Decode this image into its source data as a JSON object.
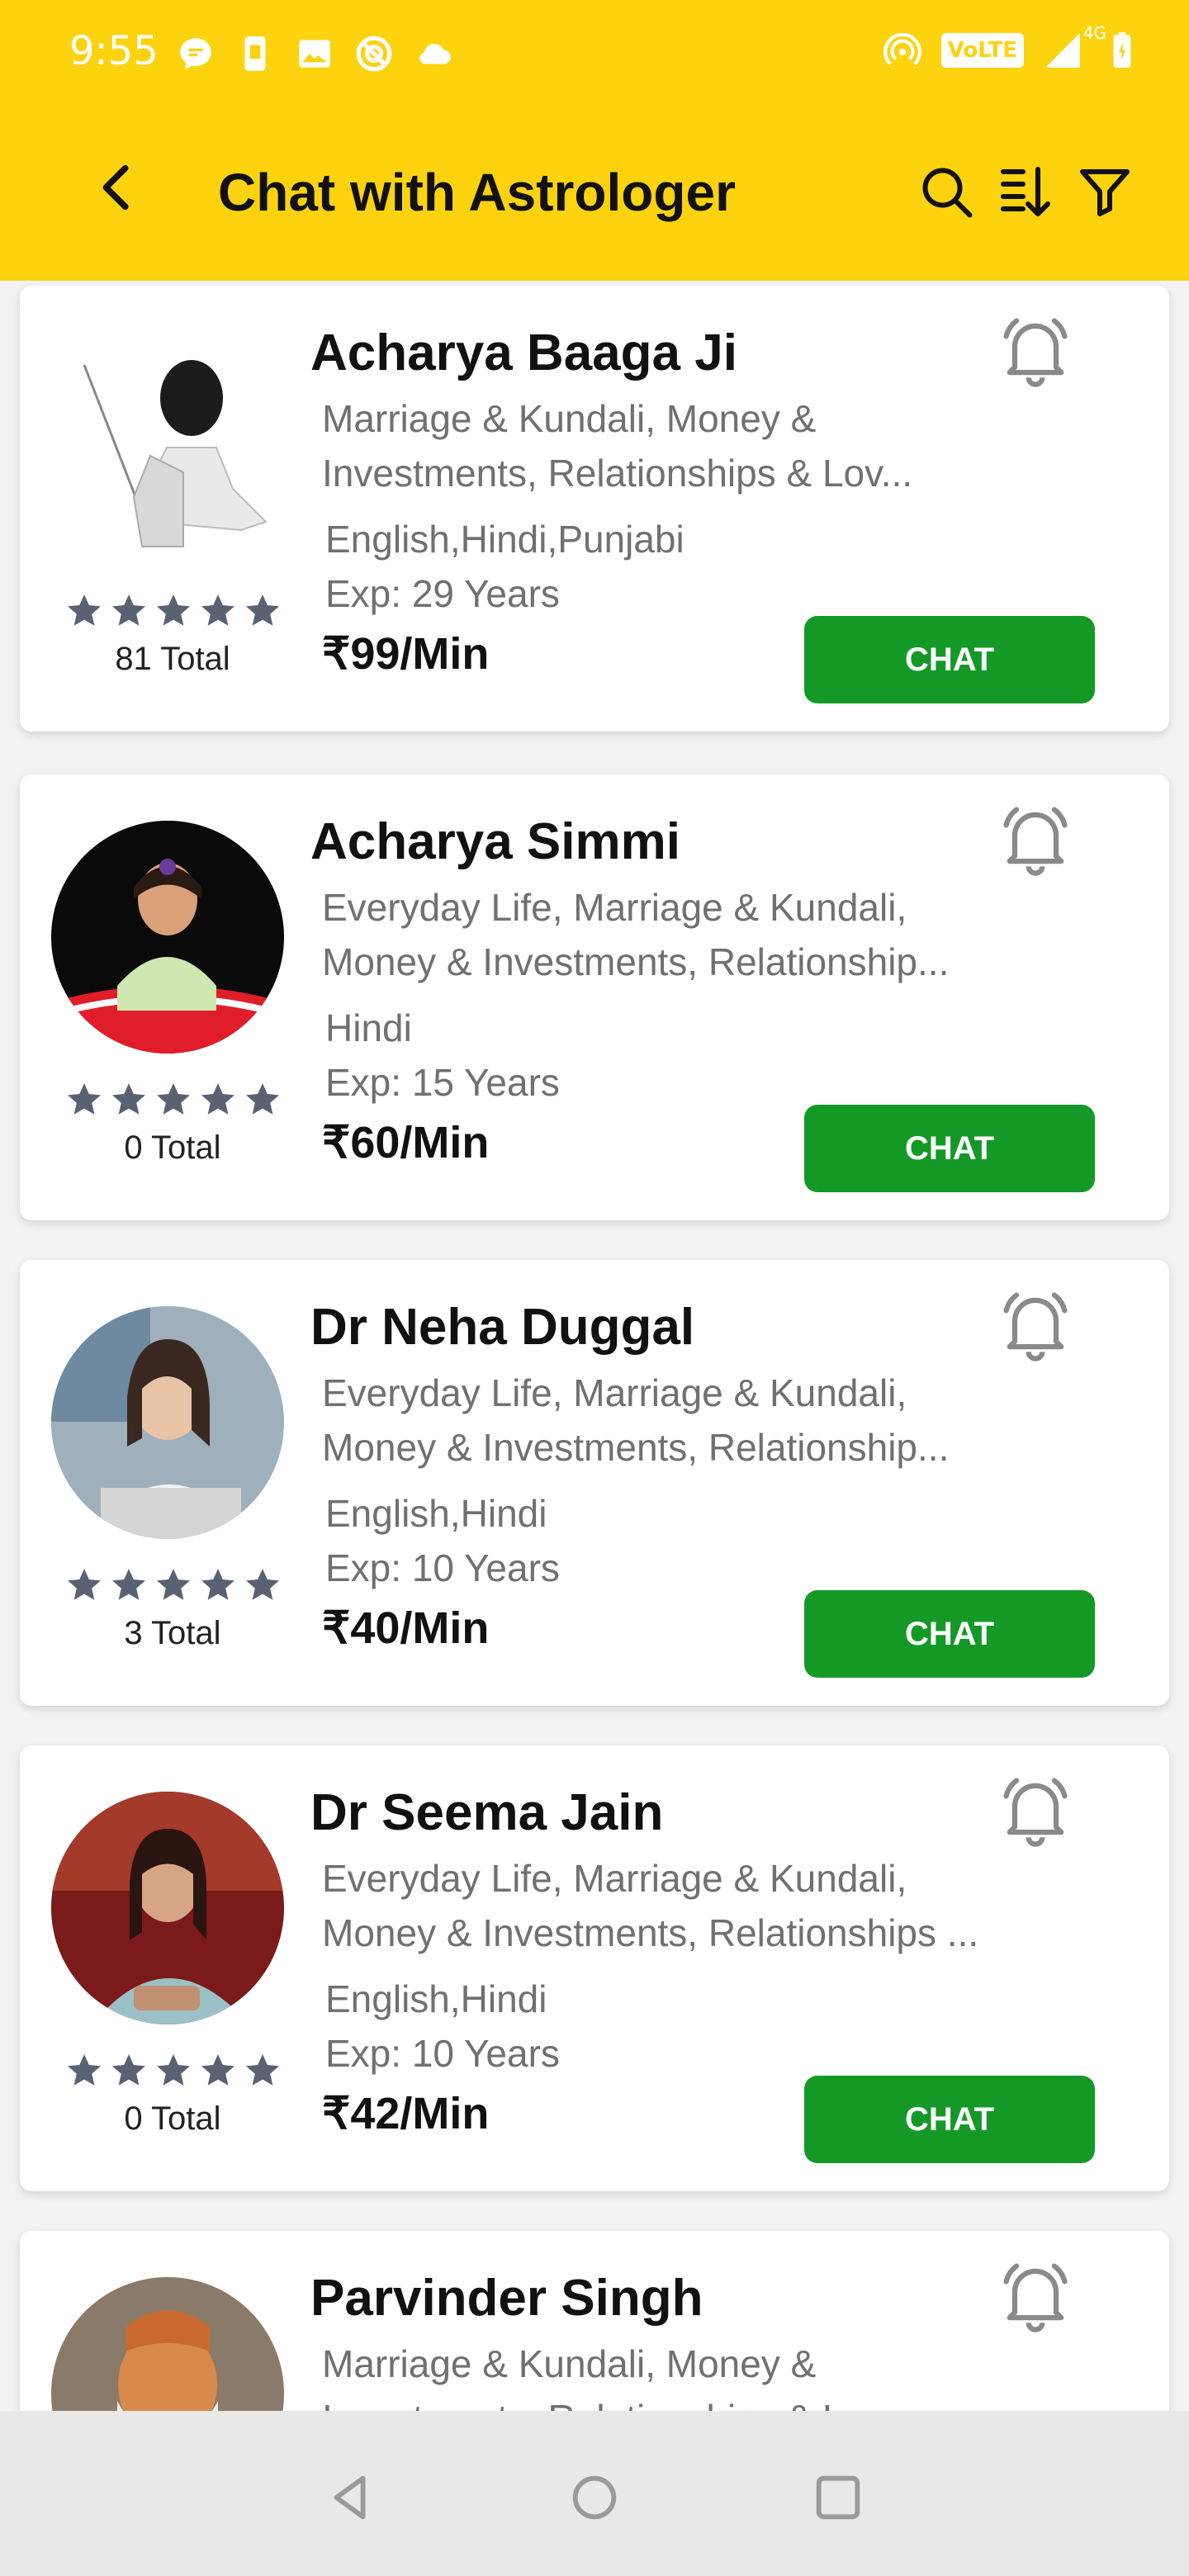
{
  "status_bar": {
    "time": "9:55",
    "volte": "VoLTE",
    "network": "4G"
  },
  "header": {
    "title": "Chat with Astrologer",
    "icons": [
      "back-arrow-icon",
      "search-icon",
      "sort-icon",
      "filter-icon"
    ],
    "background": "#FDD20F"
  },
  "astrologers": [
    {
      "name": "Acharya Baaga Ji",
      "skills": [
        "Marriage & Kundali, Money &",
        "Investments, Relationships & Lov..."
      ],
      "languages": "English,Hindi,Punjabi",
      "experience": "Exp: 29 Years",
      "price": "₹99/Min",
      "rating_total": "81 Total",
      "rating_stars": 5,
      "chat_label": "CHAT"
    },
    {
      "name": "Acharya Simmi",
      "skills": [
        "Everyday Life, Marriage & Kundali,",
        "Money & Investments, Relationship..."
      ],
      "languages": "Hindi",
      "experience": "Exp: 15 Years",
      "price": "₹60/Min",
      "rating_total": "0 Total",
      "rating_stars": 5,
      "chat_label": "CHAT"
    },
    {
      "name": "Dr Neha Duggal",
      "skills": [
        "Everyday Life, Marriage & Kundali,",
        "Money & Investments, Relationship..."
      ],
      "languages": "English,Hindi",
      "experience": "Exp: 10 Years",
      "price": "₹40/Min",
      "rating_total": "3 Total",
      "rating_stars": 5,
      "chat_label": "CHAT"
    },
    {
      "name": "Dr Seema Jain",
      "skills": [
        "Everyday Life, Marriage & Kundali,",
        "Money & Investments, Relationships ..."
      ],
      "languages": "English,Hindi",
      "experience": "Exp: 10 Years",
      "price": "₹42/Min",
      "rating_total": "0 Total",
      "rating_stars": 5,
      "chat_label": "CHAT"
    },
    {
      "name": "Parvinder Singh",
      "skills": [
        "Marriage & Kundali, Money &",
        "Investments, Relationships & Lov..."
      ]
    }
  ],
  "colors": {
    "chat_button": "#149927",
    "star": "#5a6172",
    "bell": "#8a8a8a"
  },
  "nav_bar": {
    "icons": [
      "back-triangle-icon",
      "home-circle-icon",
      "recents-square-icon"
    ]
  }
}
